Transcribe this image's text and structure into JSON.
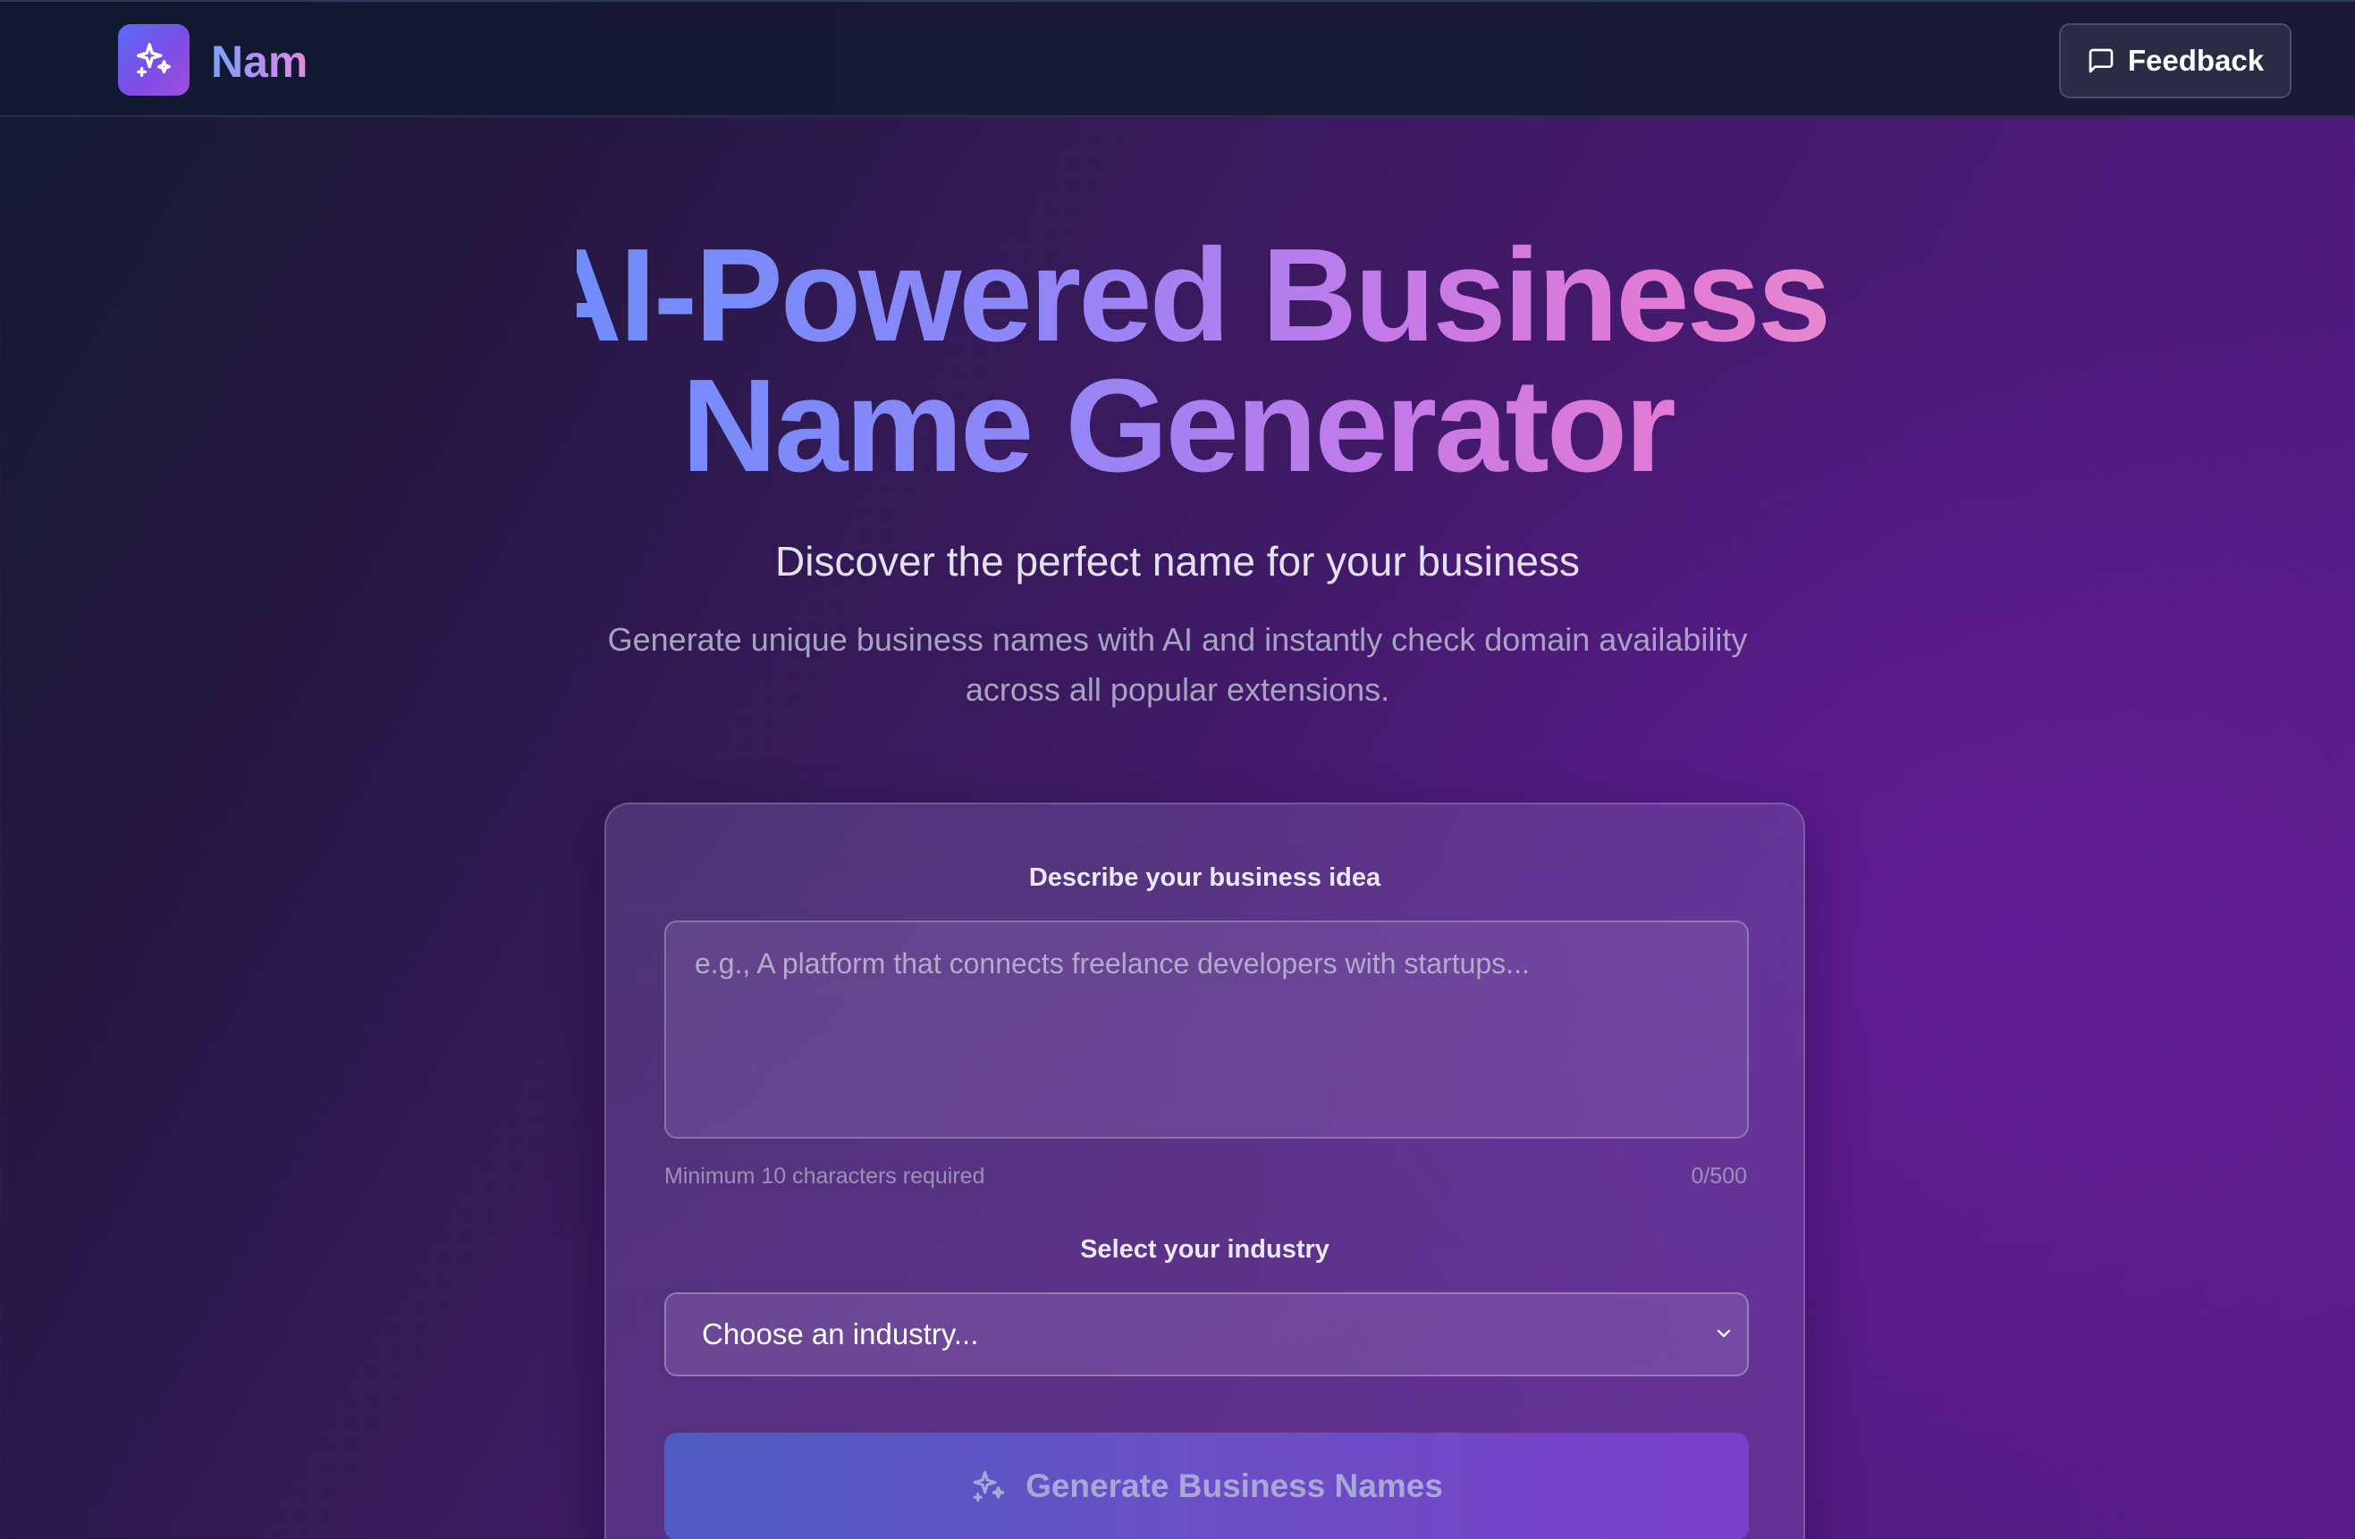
{
  "header": {
    "brand": "Nam",
    "logo_icon": "sparkles-icon",
    "feedback_label": "Feedback",
    "feedback_icon": "message-square-icon"
  },
  "hero": {
    "title_line1": "AI-Powered Business",
    "title_line2": "Name Generator",
    "subtitle": "Discover the perfect name for your business",
    "description": "Generate unique business names with AI and instantly check domain availability across all popular extensions."
  },
  "form": {
    "idea_label": "Describe your business idea",
    "idea_value": "",
    "idea_placeholder": "e.g., A platform that connects freelance developers with startups...",
    "hint": "Minimum 10 characters required",
    "counter": "0/500",
    "industry_label": "Select your industry",
    "industry_selected": "Choose an industry...",
    "generate_label": "Generate Business Names",
    "generate_icon": "sparkles-icon"
  },
  "colors": {
    "accent_blue": "#6f8dfb",
    "accent_pink": "#e37ad3",
    "background_purple": "#581c87"
  }
}
